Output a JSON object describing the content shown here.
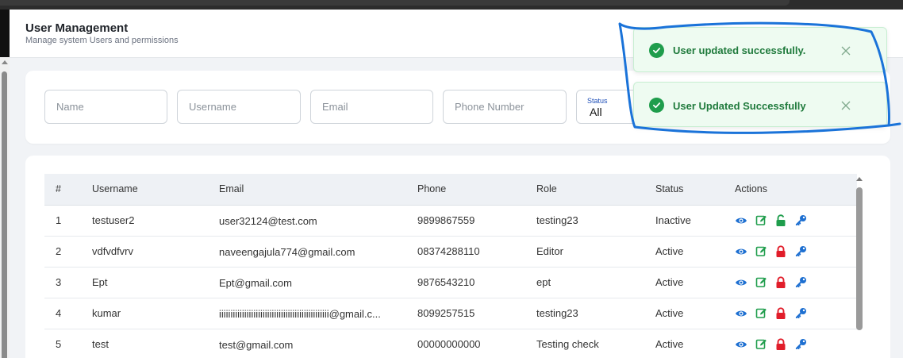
{
  "header": {
    "title": "User Management",
    "subtitle": "Manage system Users and permissions"
  },
  "filters": {
    "name_placeholder": "Name",
    "username_placeholder": "Username",
    "email_placeholder": "Email",
    "phone_placeholder": "Phone Number",
    "status_label": "Status",
    "status_value": "All"
  },
  "table": {
    "columns": [
      "#",
      "Username",
      "Email",
      "Phone",
      "Role",
      "Status",
      "Actions"
    ],
    "rows": [
      {
        "num": "1",
        "username": "testuser2",
        "email": "user32124@test.com",
        "phone": "9899867559",
        "role": "testing23",
        "status": "Inactive",
        "lock": "unlocked"
      },
      {
        "num": "2",
        "username": "vdfvdfvrv",
        "email": "naveengajula774@gmail.com",
        "phone": "08374288110",
        "role": "Editor",
        "status": "Active",
        "lock": "locked"
      },
      {
        "num": "3",
        "username": "Ept",
        "email": "Ept@gmail.com",
        "phone": "9876543210",
        "role": "ept",
        "status": "Active",
        "lock": "locked"
      },
      {
        "num": "4",
        "username": "kumar",
        "email": "iiiiiiiiiiiiiiiiiiiiiiiiiiiiiiiiiiiiiiiiiiiiiiii@gmail.c...",
        "phone": "8099257515",
        "role": "testing23",
        "status": "Active",
        "lock": "locked"
      },
      {
        "num": "5",
        "username": "test",
        "email": "test@gmail.com",
        "phone": "00000000000",
        "role": "Testing check",
        "status": "Active",
        "lock": "locked"
      }
    ]
  },
  "toasts": [
    {
      "message": "User updated successfully."
    },
    {
      "message": "User Updated Successfully"
    }
  ],
  "icons": {
    "view": "eye-icon",
    "edit": "edit-icon",
    "lock_locked": "lock-icon",
    "lock_unlocked": "unlock-icon",
    "key": "key-icon",
    "success": "check-circle-icon",
    "close": "close-icon"
  },
  "colors": {
    "view": "#1d6fd1",
    "edit": "#1f9d4c",
    "unlocked": "#1f9d4c",
    "locked": "#e11d2a",
    "key": "#1d6fd1",
    "toast_bg": "#eefbf1",
    "toast_text": "#1f7a3c",
    "annotation": "#1a73d9"
  }
}
